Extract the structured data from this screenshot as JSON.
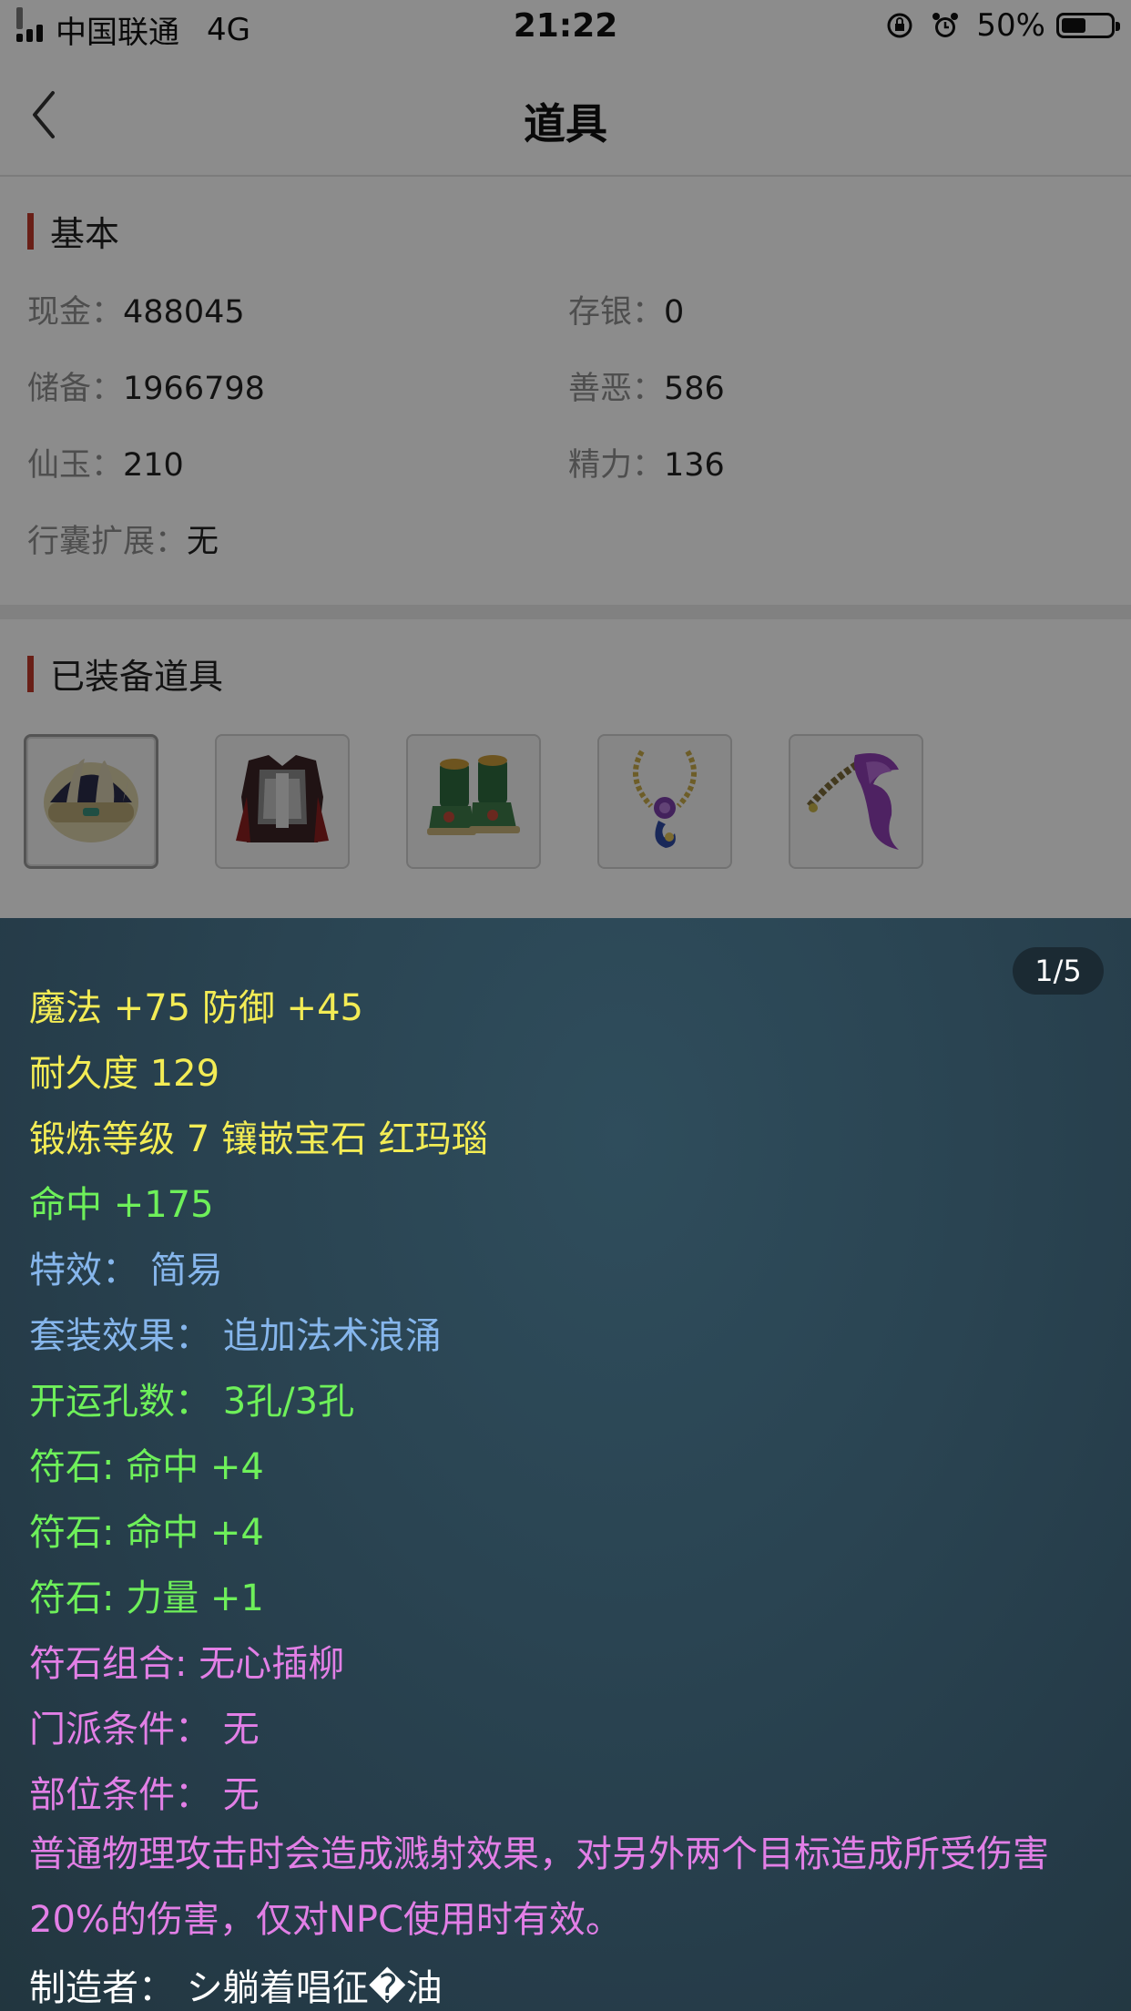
{
  "status_bar": {
    "carrier": "中国联通",
    "network": "4G",
    "time": "21:22",
    "battery": "50%",
    "battery_level": 0.5
  },
  "nav": {
    "title": "道具"
  },
  "basic": {
    "section_title": "基本",
    "items": [
      {
        "label": "现金：",
        "value": "488045"
      },
      {
        "label": "存银：",
        "value": "0"
      },
      {
        "label": "储备：",
        "value": "1966798"
      },
      {
        "label": "善恶：",
        "value": "586"
      },
      {
        "label": "仙玉：",
        "value": "210"
      },
      {
        "label": "精力：",
        "value": "136"
      },
      {
        "label": "行囊扩展：",
        "value": "无"
      }
    ]
  },
  "equipped": {
    "section_title": "已装备道具",
    "items": [
      "helmet-icon",
      "armor-icon",
      "boots-icon",
      "necklace-icon",
      "belt-icon"
    ]
  },
  "tooltip": {
    "pager": "1/5",
    "lines": [
      {
        "text": "魔法 +75 防御 +45",
        "color": "yellow"
      },
      {
        "text": "耐久度 129",
        "color": "yellow"
      },
      {
        "text": "锻炼等级 7 镶嵌宝石 红玛瑙",
        "color": "yellow"
      },
      {
        "text": "命中 +175",
        "color": "green"
      },
      {
        "text": "特效：  简易",
        "color": "blue"
      },
      {
        "text": "套装效果：  追加法术浪涌",
        "color": "blue"
      },
      {
        "text": "开运孔数：  3孔/3孔",
        "color": "green"
      },
      {
        "text": "符石: 命中 +4",
        "color": "green"
      },
      {
        "text": "符石: 命中 +4",
        "color": "green"
      },
      {
        "text": "符石: 力量 +1",
        "color": "green"
      },
      {
        "text": "符石组合: 无心插柳",
        "color": "pink"
      },
      {
        "text": "门派条件：  无",
        "color": "pink"
      },
      {
        "text": "部位条件：  无",
        "color": "pink"
      }
    ],
    "description": "普通物理攻击时会造成溅射效果，对另外两个目标造成所受伤害20%的伤害，仅对NPC使用时有效。",
    "maker": "制造者：  シ躺着唱征�油"
  }
}
